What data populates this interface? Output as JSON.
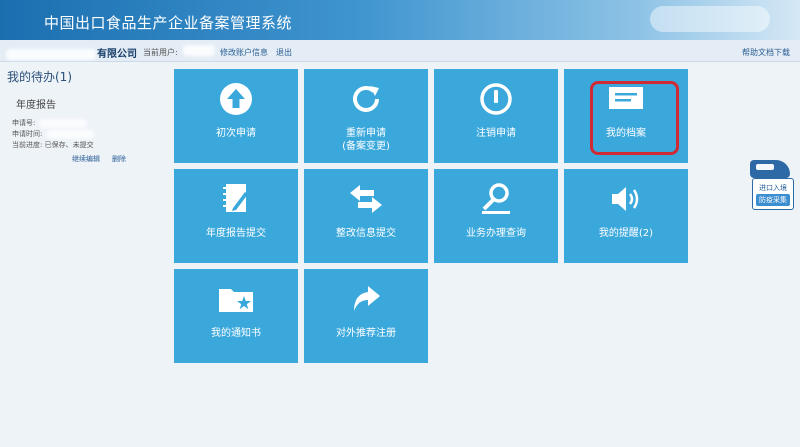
{
  "header": {
    "title": "中国出口食品生产企业备案管理系统"
  },
  "topbar": {
    "company_suffix": "有限公司",
    "current_user_label": "当前用户:",
    "edit_account": "修改账户信息",
    "logout": "退出",
    "help_doc": "帮助文档下载"
  },
  "todo": {
    "title": "我的待办(1)",
    "item_title": "年度报告",
    "apply_no_label": "申请号:",
    "apply_time_label": "申请时间:",
    "progress_label": "当前进度:",
    "progress_value": "已保存、未提交",
    "continue_edit": "继续编辑",
    "delete": "删除"
  },
  "tiles": [
    {
      "label": "初次申请",
      "sub": "",
      "icon": "arrow-up-circle-icon"
    },
    {
      "label": "重新申请",
      "sub": "(备案变更)",
      "icon": "refresh-icon"
    },
    {
      "label": "注销申请",
      "sub": "",
      "icon": "power-icon"
    },
    {
      "label": "我的档案",
      "sub": "",
      "icon": "archive-card-icon"
    },
    {
      "label": "年度报告提交",
      "sub": "",
      "icon": "notebook-pen-icon"
    },
    {
      "label": "整改信息提交",
      "sub": "",
      "icon": "swap-arrows-icon"
    },
    {
      "label": "业务办理查询",
      "sub": "",
      "icon": "search-icon"
    },
    {
      "label": "我的提醒(2)",
      "sub": "",
      "icon": "speaker-icon"
    },
    {
      "label": "我的通知书",
      "sub": "",
      "icon": "folder-star-icon"
    },
    {
      "label": "对外推荐注册",
      "sub": "",
      "icon": "share-arrow-icon"
    }
  ],
  "float_badge": {
    "line1": "进口入境",
    "line2": "防疫采集"
  },
  "colors": {
    "tile": "#3ba8dc",
    "highlight": "#d02a35",
    "header": "#1b6fb0"
  }
}
